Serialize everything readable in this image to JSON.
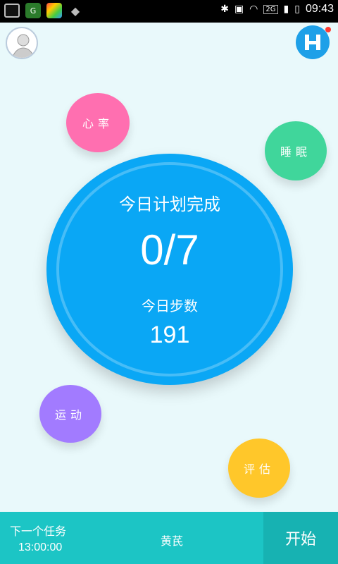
{
  "statusbar": {
    "time": "09:43",
    "network": "2G"
  },
  "header": {
    "avatar_icon": "user-avatar-icon",
    "logo_icon": "h-logo-icon"
  },
  "bubbles": {
    "heart": "心率",
    "sleep": "睡眠",
    "sport": "运动",
    "eval": "评估"
  },
  "main": {
    "plan_title": "今日计划完成",
    "plan_value": "0/7",
    "steps_title": "今日步数",
    "steps_value": "191"
  },
  "bottom": {
    "next_label": "下一个任务",
    "next_time": "13:00:00",
    "person": "黄芪",
    "start_label": "开始"
  },
  "colors": {
    "background": "#e9f9fb",
    "primary_circle": "#0aa7f5",
    "heart": "#ff6fb0",
    "sleep": "#40d69b",
    "sport": "#a27bff",
    "eval": "#ffc72a",
    "bottom_bar": "#1cc5c5",
    "start_button": "#17b2b2"
  }
}
